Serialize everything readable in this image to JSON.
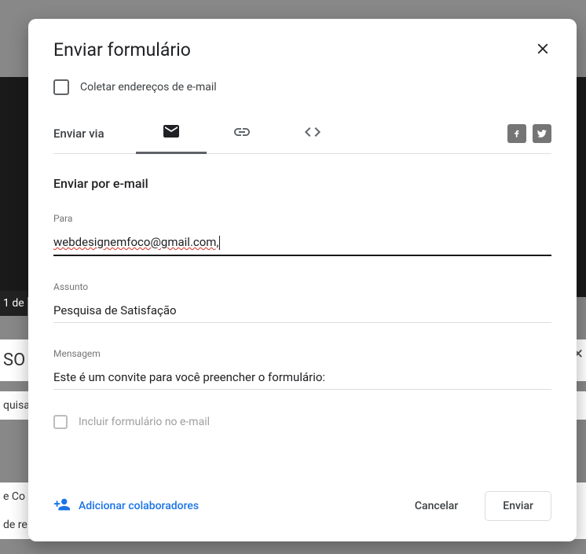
{
  "backdrop": {
    "date_fragment": "1 de",
    "title_fragment": "SO",
    "close_fragment": "×",
    "crumb1": "quisa d",
    "crumb2": "e Co",
    "crumb3": "de re"
  },
  "dialog": {
    "title": "Enviar formulário",
    "collect_emails_label": "Coletar endereços de e-mail",
    "send_via_label": "Enviar via",
    "section_title": "Enviar por e-mail",
    "fields": {
      "to": {
        "label": "Para",
        "value": "webdesignemfoco@gmail.com,"
      },
      "subject": {
        "label": "Assunto",
        "value": "Pesquisa de Satisfação"
      },
      "message": {
        "label": "Mensagem",
        "value": "Este é um convite para você preencher o formulário:"
      }
    },
    "include_form_label": "Incluir formulário no e-mail",
    "add_collaborators": "Adicionar colaboradores",
    "cancel": "Cancelar",
    "send": "Enviar"
  }
}
